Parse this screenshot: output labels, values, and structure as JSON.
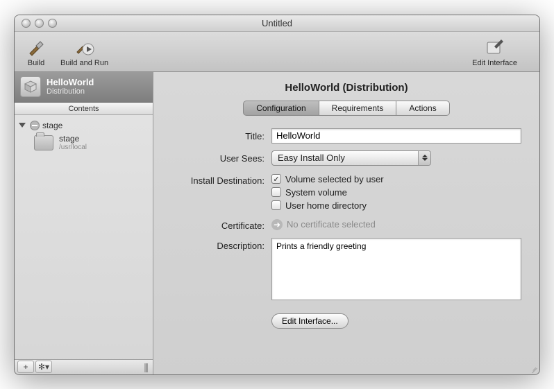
{
  "window": {
    "title": "Untitled"
  },
  "toolbar": {
    "build": "Build",
    "build_run": "Build and Run",
    "edit_interface": "Edit Interface"
  },
  "sidebar": {
    "header_title": "HelloWorld",
    "header_subtitle": "Distribution",
    "tab": "Contents",
    "tree_root": "stage",
    "folder_name": "stage",
    "folder_path": "/usr/local"
  },
  "main": {
    "title": "HelloWorld (Distribution)",
    "tabs": {
      "config": "Configuration",
      "req": "Requirements",
      "actions": "Actions"
    },
    "labels": {
      "title": "Title:",
      "user_sees": "User Sees:",
      "install_dest": "Install Destination:",
      "certificate": "Certificate:",
      "description": "Description:"
    },
    "values": {
      "title": "HelloWorld",
      "user_sees": "Easy Install Only",
      "certificate": "No certificate selected",
      "description": "Prints a friendly greeting"
    },
    "install_options": {
      "volume_user": "Volume selected by user",
      "system_volume": "System volume",
      "user_home": "User home directory"
    },
    "edit_interface_btn": "Edit Interface..."
  }
}
